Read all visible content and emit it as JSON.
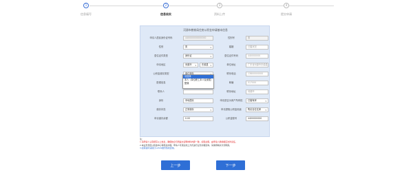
{
  "steps": [
    {
      "number": "1",
      "label": "信息填写"
    },
    {
      "number": "2",
      "label": "信息核实"
    },
    {
      "number": "3",
      "label": "资料上传"
    },
    {
      "number": "4",
      "label": "提交申请"
    }
  ],
  "form_title": "河源市教育局住房公积金申请基本信息",
  "rows": [
    {
      "label": "申请人居民身份证号码",
      "value": "440000000000000",
      "label2": "性别号",
      "value2": "男"
    },
    {
      "label": "性别",
      "value": "男",
      "label2": "婚姻",
      "value2": "已婚状况"
    },
    {
      "label": "居住证件类型",
      "value": "身份证",
      "label2": "居住证件号码",
      "value2": "440000000"
    },
    {
      "label": "申请地区",
      "value": "河源市",
      "value_b": "东源县",
      "label2": "单位地址",
      "value2": "广东省河源市东源县"
    },
    {
      "label": "公积金缴存类型",
      "value": "单位缴存",
      "label2": "联系电话",
      "value2": "13800000000"
    },
    {
      "label": "配偶信息",
      "value": "",
      "label2": "邮编",
      "value2": "517000"
    },
    {
      "label": "联系人",
      "value": "",
      "label2": "联系地址",
      "value2": "河源市"
    },
    {
      "label": "身份",
      "value": "本地居民",
      "label2": "申请是否为房产所有权",
      "value2": "已婚有房"
    },
    {
      "label": "缴存状态",
      "value": "正常缴存",
      "label2": "申请提取公积金用途",
      "value2": "购买自住住房"
    },
    {
      "label": "申请缴存余额",
      "value": "0.00",
      "label2": "公积金账号",
      "value2": "4400000000"
    }
  ],
  "dropdown_options": [
    "请选择",
    "本人（单位职工本人及家属）（含配偶）",
    "配偶"
  ],
  "notes": [
    "注：",
    "1.请申请人认真填写以上信息，确保信息与所提交证明材料内容一致，如有虚假，由申请人承担相应法律责任。",
    "2.本业务须经公积金中心审核后办理，申请人可通过线上方式进行业务办理查询，请保持联系方式畅通。",
    "3.如有疑问请拨打12329服务热线咨询。"
  ],
  "buttons": {
    "prev": "上一步",
    "next": "下一步"
  }
}
